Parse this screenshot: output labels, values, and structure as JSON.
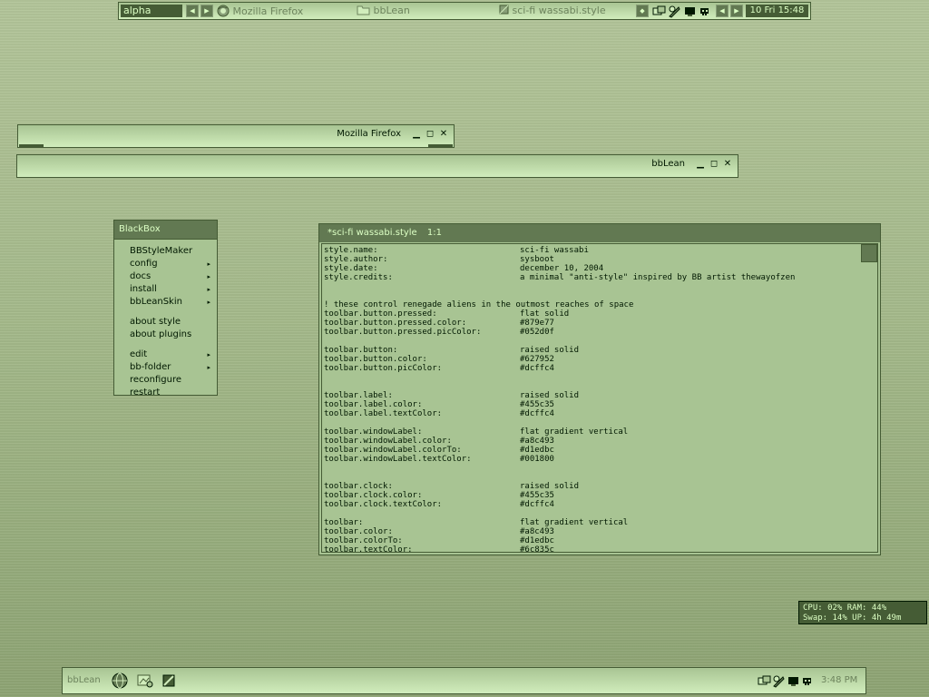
{
  "top_toolbar": {
    "workspace": "alpha",
    "tasks": [
      {
        "label": "Mozilla Firefox",
        "icon": "firefox-icon"
      },
      {
        "label": "bbLean",
        "icon": "folder-icon"
      },
      {
        "label": "sci-fi wassabi.style",
        "icon": "document-icon"
      }
    ],
    "clock": "10 Fri 15:48"
  },
  "windows": {
    "firefox": {
      "title": "Mozilla Firefox"
    },
    "bblean": {
      "title": "bbLean"
    }
  },
  "menu": {
    "title": "BlackBox",
    "items": [
      {
        "label": "BBStyleMaker",
        "submenu": false
      },
      {
        "label": "config",
        "submenu": true
      },
      {
        "label": "docs",
        "submenu": true
      },
      {
        "label": "install",
        "submenu": true
      },
      {
        "label": "bbLeanSkin",
        "submenu": true
      },
      {
        "label": "about style",
        "submenu": false
      },
      {
        "label": "about plugins",
        "submenu": false
      },
      {
        "label": "edit",
        "submenu": true
      },
      {
        "label": "bb-folder",
        "submenu": true
      },
      {
        "label": "reconfigure",
        "submenu": false
      },
      {
        "label": "restart",
        "submenu": false
      }
    ],
    "arrow": "▸"
  },
  "editor": {
    "title": "*sci-fi wassabi.style",
    "position": "1:1",
    "lines": [
      {
        "k": "style.name:",
        "v": "sci-fi wassabi"
      },
      {
        "k": "style.author:",
        "v": "sysboot"
      },
      {
        "k": "style.date:",
        "v": "december 10, 2004"
      },
      {
        "k": "style.credits:",
        "v": "a minimal \"anti-style\" inspired by BB artist thewayofzen"
      },
      {
        "k": "",
        "v": ""
      },
      {
        "k": "",
        "v": ""
      },
      {
        "k": "! these control renegade aliens in the outmost reaches of space",
        "v": ""
      },
      {
        "k": "toolbar.button.pressed:",
        "v": "flat solid"
      },
      {
        "k": "toolbar.button.pressed.color:",
        "v": "#879e77"
      },
      {
        "k": "toolbar.button.pressed.picColor:",
        "v": "#052d0f"
      },
      {
        "k": "",
        "v": ""
      },
      {
        "k": "toolbar.button:",
        "v": "raised solid"
      },
      {
        "k": "toolbar.button.color:",
        "v": "#627952"
      },
      {
        "k": "toolbar.button.picColor:",
        "v": "#dcffc4"
      },
      {
        "k": "",
        "v": ""
      },
      {
        "k": "",
        "v": ""
      },
      {
        "k": "toolbar.label:",
        "v": "raised solid"
      },
      {
        "k": "toolbar.label.color:",
        "v": "#455c35"
      },
      {
        "k": "toolbar.label.textColor:",
        "v": "#dcffc4"
      },
      {
        "k": "",
        "v": ""
      },
      {
        "k": "toolbar.windowLabel:",
        "v": "flat gradient vertical"
      },
      {
        "k": "toolbar.windowLabel.color:",
        "v": "#a8c493"
      },
      {
        "k": "toolbar.windowLabel.colorTo:",
        "v": "#d1edbc"
      },
      {
        "k": "toolbar.windowLabel.textColor:",
        "v": "#001800"
      },
      {
        "k": "",
        "v": ""
      },
      {
        "k": "",
        "v": ""
      },
      {
        "k": "toolbar.clock:",
        "v": "raised solid"
      },
      {
        "k": "toolbar.clock.color:",
        "v": "#455c35"
      },
      {
        "k": "toolbar.clock.textColor:",
        "v": "#dcffc4"
      },
      {
        "k": "",
        "v": ""
      },
      {
        "k": "toolbar:",
        "v": "flat gradient vertical"
      },
      {
        "k": "toolbar.color:",
        "v": "#a8c493"
      },
      {
        "k": "toolbar.colorTo:",
        "v": "#d1edbc"
      },
      {
        "k": "toolbar.textColor:",
        "v": "#6c835c"
      }
    ]
  },
  "sysmon": {
    "line1": "CPU: 02% RAM: 44%",
    "line2": "Swap: 14% UP: 4h 49m"
  },
  "bottom_toolbar": {
    "label": "bbLean",
    "clock": "3:48 PM"
  },
  "colors": {
    "button": "#627952",
    "button_pressed": "#879e77",
    "label": "#455c35",
    "text_light": "#dcffc4",
    "gradient_from": "#a8c493",
    "gradient_to": "#d1edbc",
    "text_dark": "#001800",
    "toolbar_text": "#6c835c"
  }
}
